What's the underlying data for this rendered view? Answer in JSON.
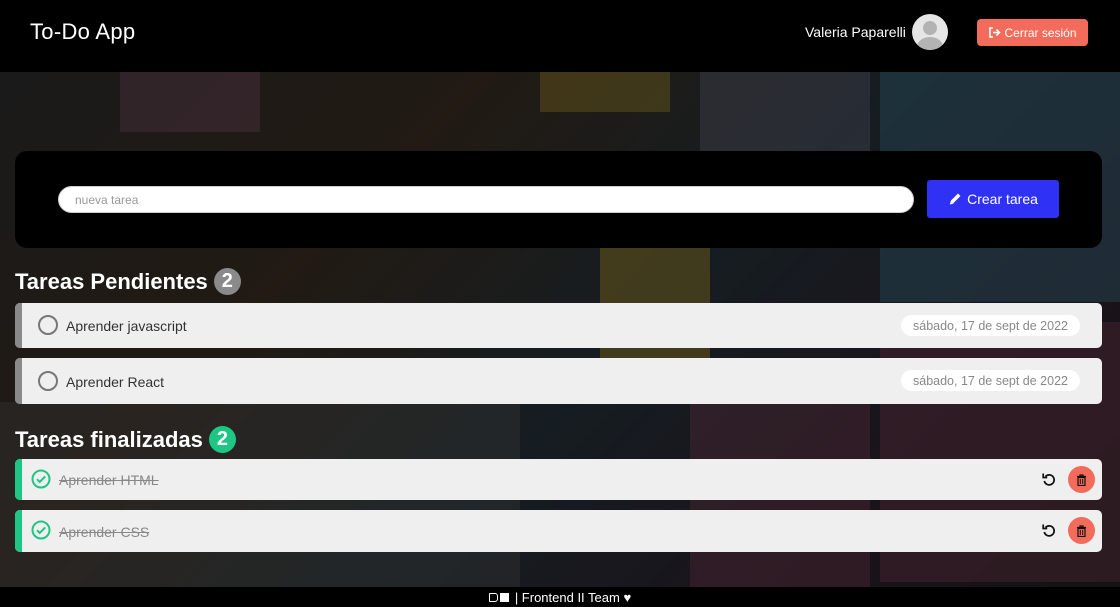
{
  "header": {
    "app_title": "To-Do App",
    "user_name": "Valeria Paparelli",
    "logout_label": "Cerrar sesión"
  },
  "new_task": {
    "placeholder": "nueva tarea",
    "value": "",
    "create_label": "Crear tarea"
  },
  "pending": {
    "title": "Tareas Pendientes",
    "count": "2",
    "items": [
      {
        "label": "Aprender javascript",
        "date": "sábado, 17 de sept de 2022"
      },
      {
        "label": "Aprender React",
        "date": "sábado, 17 de sept de 2022"
      }
    ]
  },
  "finished": {
    "title": "Tareas finalizadas",
    "count": "2",
    "items": [
      {
        "label": "Aprender HTML"
      },
      {
        "label": "Aprender CSS"
      }
    ]
  },
  "footer": {
    "text": "| Frontend II Team ♥"
  },
  "colors": {
    "accent_blue": "#2f31f5",
    "danger": "#f26b5b",
    "success": "#1dc783",
    "pending_bar": "#8a8a8a"
  },
  "icons": {
    "logout": "sign-out-icon",
    "create": "pencil-icon",
    "pending_item": "empty-circle-icon",
    "done_item": "check-circle-icon",
    "restore": "undo-icon",
    "delete": "trash-icon"
  }
}
